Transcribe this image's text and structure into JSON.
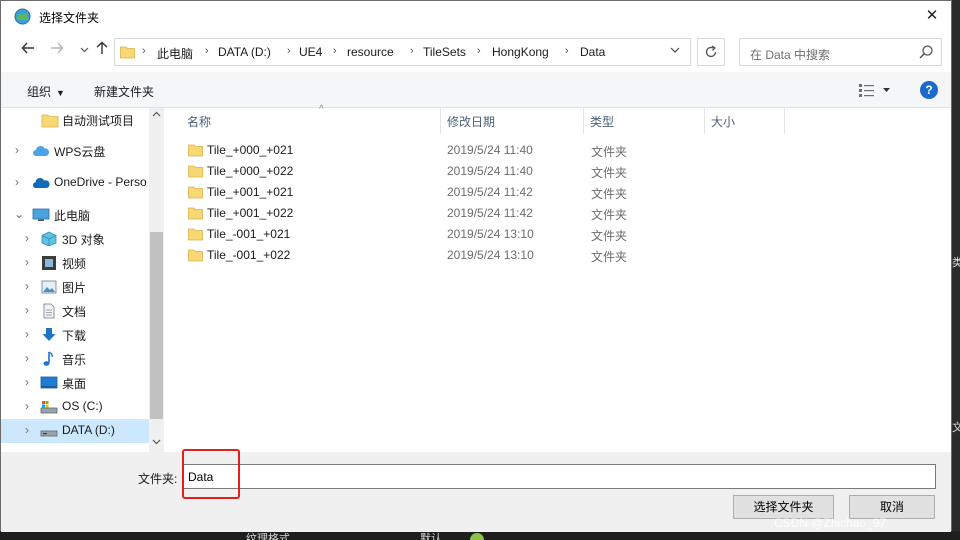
{
  "window": {
    "title": "选择文件夹",
    "close_label": "✕"
  },
  "navigation": {
    "back_icon": "arrow-left-icon",
    "forward_icon": "arrow-right-icon",
    "up_icon": "arrow-up-icon",
    "address_crumbs": [
      "此电脑",
      "DATA (D:)",
      "UE4",
      "resource",
      "TileSets",
      "HongKong",
      "Data"
    ],
    "search_placeholder": "在 Data 中搜索"
  },
  "toolbar": {
    "organize_label": "组织",
    "new_folder_label": "新建文件夹"
  },
  "sidebar": {
    "items": [
      {
        "label": "自动测试项目",
        "icon": "folder-icon",
        "expandable": false,
        "indent": 1,
        "selected": false
      },
      {
        "label": "WPS云盘",
        "icon": "cloud-icon",
        "expandable": true,
        "expanded": false,
        "indent": 0,
        "selected": false
      },
      {
        "label": "OneDrive - Perso",
        "icon": "onedrive-icon",
        "expandable": true,
        "expanded": false,
        "indent": 0,
        "selected": false
      },
      {
        "label": "此电脑",
        "icon": "computer-icon",
        "expandable": true,
        "expanded": true,
        "indent": 0,
        "selected": false
      },
      {
        "label": "3D 对象",
        "icon": "cube-icon",
        "expandable": true,
        "expanded": false,
        "indent": 1,
        "selected": false
      },
      {
        "label": "视频",
        "icon": "video-icon",
        "expandable": true,
        "expanded": false,
        "indent": 1,
        "selected": false
      },
      {
        "label": "图片",
        "icon": "picture-icon",
        "expandable": true,
        "expanded": false,
        "indent": 1,
        "selected": false
      },
      {
        "label": "文档",
        "icon": "document-icon",
        "expandable": true,
        "expanded": false,
        "indent": 1,
        "selected": false
      },
      {
        "label": "下载",
        "icon": "download-icon",
        "expandable": true,
        "expanded": false,
        "indent": 1,
        "selected": false
      },
      {
        "label": "音乐",
        "icon": "music-icon",
        "expandable": true,
        "expanded": false,
        "indent": 1,
        "selected": false
      },
      {
        "label": "桌面",
        "icon": "desktop-icon",
        "expandable": true,
        "expanded": false,
        "indent": 1,
        "selected": false
      },
      {
        "label": "OS (C:)",
        "icon": "os-drive-icon",
        "expandable": true,
        "expanded": false,
        "indent": 1,
        "selected": false
      },
      {
        "label": "DATA (D:)",
        "icon": "drive-icon",
        "expandable": true,
        "expanded": false,
        "indent": 1,
        "selected": true
      }
    ]
  },
  "file_list": {
    "columns": [
      "名称",
      "修改日期",
      "类型",
      "大小"
    ],
    "rows": [
      {
        "name": "Tile_+000_+021",
        "date": "2019/5/24 11:40",
        "type": "文件夹",
        "size": ""
      },
      {
        "name": "Tile_+000_+022",
        "date": "2019/5/24 11:40",
        "type": "文件夹",
        "size": ""
      },
      {
        "name": "Tile_+001_+021",
        "date": "2019/5/24 11:42",
        "type": "文件夹",
        "size": ""
      },
      {
        "name": "Tile_+001_+022",
        "date": "2019/5/24 11:42",
        "type": "文件夹",
        "size": ""
      },
      {
        "name": "Tile_-001_+021",
        "date": "2019/5/24 13:10",
        "type": "文件夹",
        "size": ""
      },
      {
        "name": "Tile_-001_+022",
        "date": "2019/5/24 13:10",
        "type": "文件夹",
        "size": ""
      }
    ]
  },
  "footer": {
    "folder_label": "文件夹:",
    "folder_value": "Data",
    "select_button": "选择文件夹",
    "cancel_button": "取消"
  },
  "background": {
    "bottom_text_1": "纹理格式",
    "bottom_text_2": "默认",
    "edge_text_1": "类",
    "edge_text_2": "文"
  },
  "watermark": "CSDN @Zhichao_97",
  "colors": {
    "selection": "#cce8ff",
    "header_text": "#4c607a",
    "highlight_border": "#e0201c",
    "folder_yellow": "#f8d775",
    "help_blue": "#1b6ac9"
  }
}
